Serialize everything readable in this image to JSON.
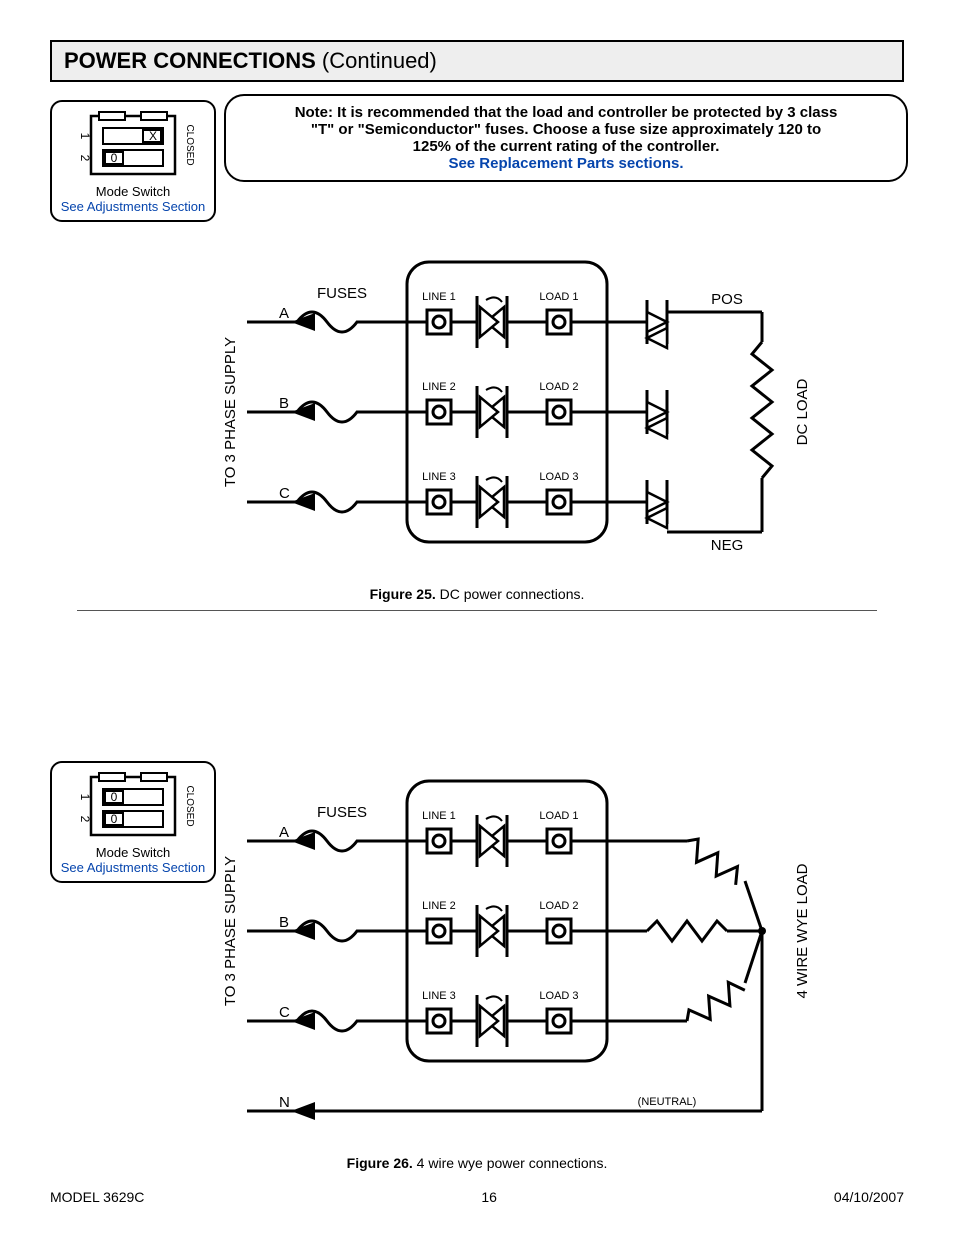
{
  "header": {
    "title_bold": "POWER CONNECTIONS",
    "title_cont": " (Continued)"
  },
  "note": {
    "line1": "Note: It is recommended that the load and controller be protected by 3 class",
    "line2": "\"T\" or \"Semiconductor\" fuses. Choose a fuse size approximately 120 to",
    "line3": "125% of the current rating of the controller.",
    "link": "See Replacement Parts sections."
  },
  "mode1": {
    "title": "Mode Switch",
    "link": "See Adjustments Section",
    "sw1": "X",
    "sw2": "0",
    "n1": "1",
    "n2": "2",
    "closed": "CLOSED"
  },
  "mode2": {
    "title": "Mode Switch",
    "link": "See Adjustments Section",
    "sw1": "0",
    "sw2": "0",
    "n1": "1",
    "n2": "2",
    "closed": "CLOSED"
  },
  "circuit": {
    "fuses": "FUSES",
    "supply": "TO 3 PHASE SUPPLY",
    "a": "A",
    "b": "B",
    "c": "C",
    "n": "N",
    "line1": "LINE 1",
    "line2": "LINE 2",
    "line3": "LINE 3",
    "load1": "LOAD 1",
    "load2": "LOAD 2",
    "load3": "LOAD 3",
    "pos": "POS",
    "neg": "NEG",
    "dcload": "DC LOAD",
    "wyeload": "4 WIRE WYE LOAD",
    "neutral": "(NEUTRAL)"
  },
  "fig25": {
    "label": "Figure 25.",
    "text": "  DC power connections."
  },
  "fig26": {
    "label": "Figure 26.",
    "text": "  4 wire wye power connections."
  },
  "footer": {
    "model": "MODEL 3629C",
    "page": "16",
    "date": "04/10/2007"
  }
}
